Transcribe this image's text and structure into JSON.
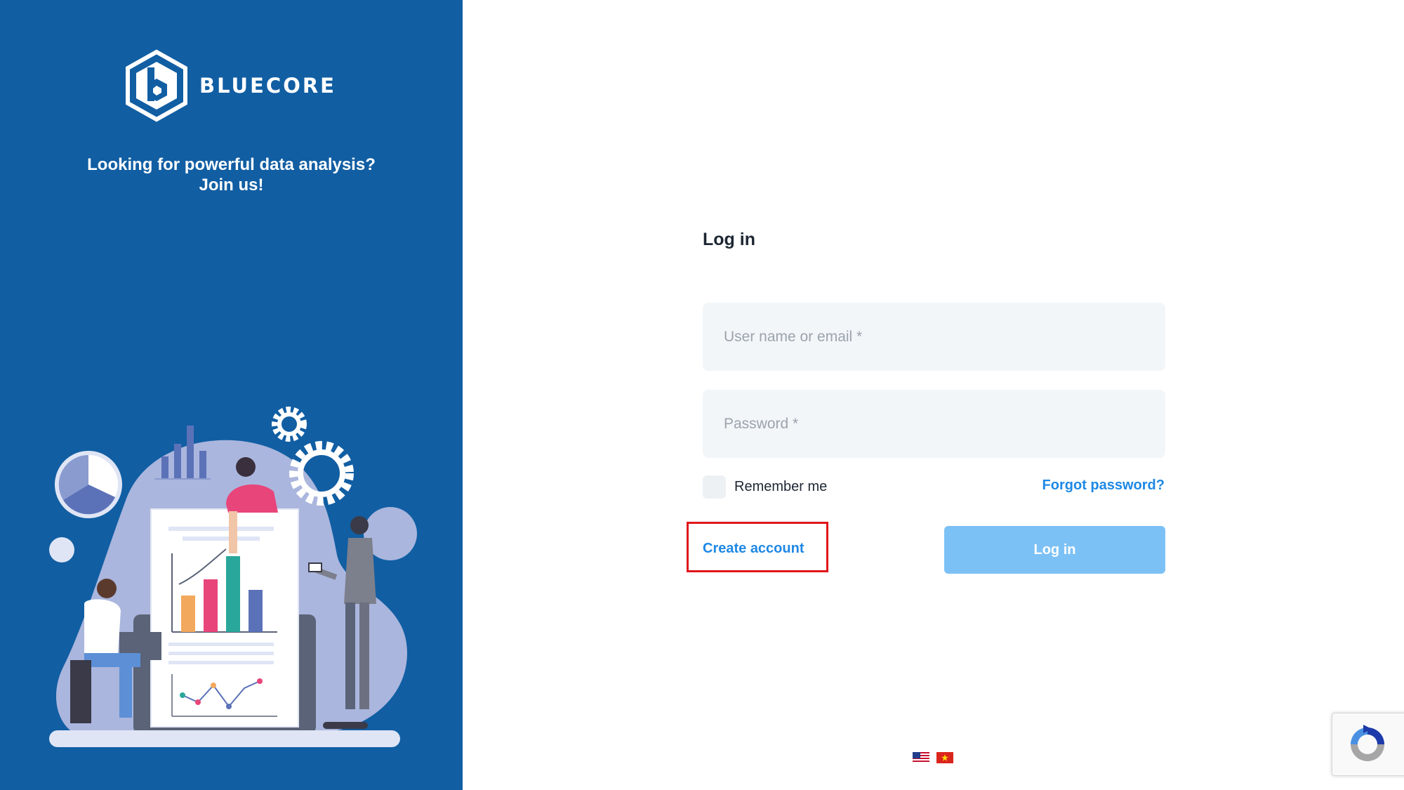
{
  "brand": {
    "name": "BLUECORE",
    "tagline_line1": "Looking for powerful data analysis?",
    "tagline_line2": "Join us!"
  },
  "form": {
    "title": "Log in",
    "username_placeholder": "User name or email *",
    "password_placeholder": "Password *",
    "remember_label": "Remember me",
    "forgot_label": "Forgot password?",
    "create_account_label": "Create account",
    "login_button_label": "Log in"
  },
  "languages": [
    "english-flag-icon",
    "vietnamese-flag-icon"
  ],
  "colors": {
    "panel": "#115ea3",
    "link": "#1e88e5",
    "button": "#7cc1f5",
    "highlight": "#e0161b",
    "field": "#f3f6f9"
  }
}
